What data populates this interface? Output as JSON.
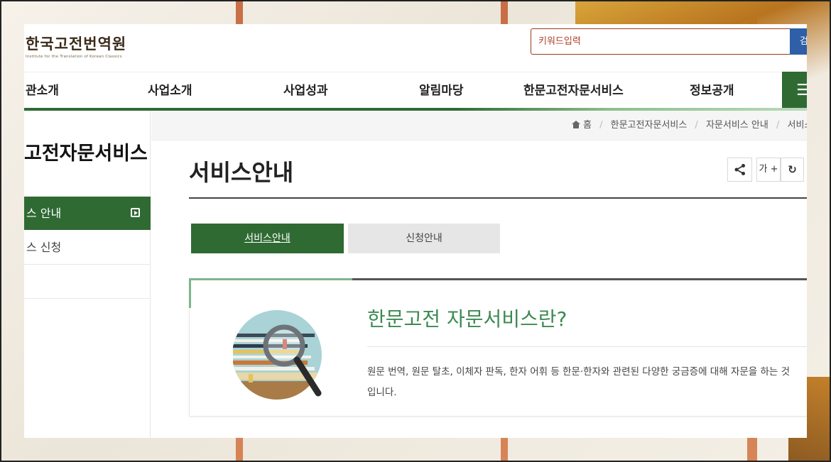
{
  "header": {
    "logo_kr": "한국고전번역원",
    "logo_en": "Institute for the Translation of Korean Classics",
    "search_placeholder": "키워드입력",
    "search_button": "검"
  },
  "nav": {
    "items": [
      {
        "label": "관소개"
      },
      {
        "label": "사업소개"
      },
      {
        "label": "사업성과"
      },
      {
        "label": "알림마당"
      },
      {
        "label": "한문고전자문서비스"
      },
      {
        "label": "정보공개"
      }
    ],
    "menu_icon": "hamburger-icon"
  },
  "sidebar": {
    "title": "고전자문서비스",
    "items": [
      {
        "label": "스 안내",
        "active": true
      },
      {
        "label": "스 신청",
        "active": false
      }
    ]
  },
  "breadcrumb": {
    "home": "홈",
    "items": [
      "한문고전자문서비스",
      "자문서비스 안내",
      "서비스"
    ]
  },
  "page": {
    "title": "서비스안내",
    "font_size_button": "가 +"
  },
  "tabs": [
    {
      "label": "서비스안내",
      "active": true
    },
    {
      "label": "신청안내",
      "active": false
    }
  ],
  "content": {
    "heading": "한문고전 자문서비스란?",
    "description": "원문 번역, 원문 탈초, 이체자 판독, 한자 어휘 등 한문·한자와 관련된 다양한 궁금증에 대해 자문을 하는 것입니다."
  },
  "colors": {
    "primary_green": "#2f6a33",
    "heading_green": "#3c8a52",
    "search_blue": "#2e5fa7"
  }
}
